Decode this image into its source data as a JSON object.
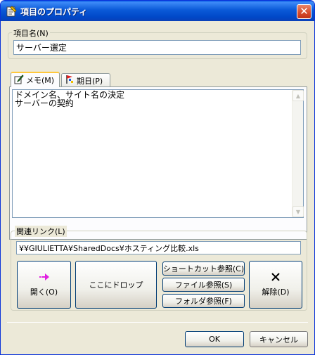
{
  "window": {
    "title": "項目のプロパティ",
    "close_glyph": "✕"
  },
  "name_group": {
    "label": "項目名(N)",
    "value": "サーバー選定"
  },
  "tabs": [
    {
      "label": "メモ(M)",
      "icon": "memo-icon",
      "active": true
    },
    {
      "label": "期日(P)",
      "icon": "flag-icon",
      "active": false
    }
  ],
  "memo": {
    "text": "ドメイン名、サイト名の決定\nサーバーの契約"
  },
  "link_group": {
    "label": "関連リンク(L)",
    "path": "¥¥GIULIETTA¥SharedDocs¥ホスティング比較.xls",
    "open_label": "開く(O)",
    "drop_label": "ここにドロップ",
    "shortcut_label": "ショートカット参照(C)",
    "file_label": "ファイル参照(S)",
    "folder_label": "フォルダ参照(F)",
    "remove_label": "解除(D)"
  },
  "footer": {
    "ok_label": "OK",
    "cancel_label": "キャンセル"
  },
  "colors": {
    "titlebar": "#0b5ad8",
    "dialog_bg": "#ece9d8",
    "arrow": "#e020e0"
  }
}
